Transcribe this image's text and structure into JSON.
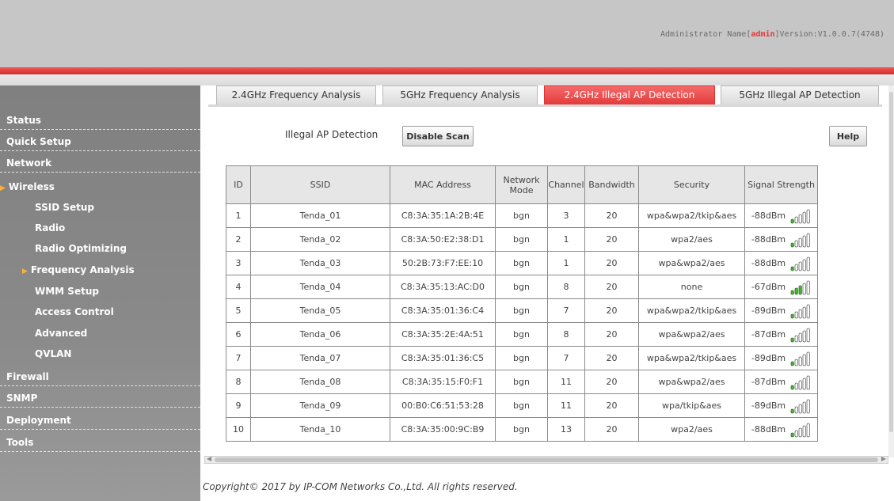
{
  "header": {
    "admin_label": "Administrator Name[",
    "admin_name": "admin",
    "version_label": "]Version:V1.0.0.7(4748)"
  },
  "sidebar": {
    "items": [
      {
        "label": "Status"
      },
      {
        "label": "Quick Setup"
      },
      {
        "label": "Network"
      },
      {
        "label": "Wireless"
      },
      {
        "label": "SSID Setup"
      },
      {
        "label": "Radio"
      },
      {
        "label": "Radio Optimizing"
      },
      {
        "label": "Frequency Analysis"
      },
      {
        "label": "WMM Setup"
      },
      {
        "label": "Access Control"
      },
      {
        "label": "Advanced"
      },
      {
        "label": "QVLAN"
      },
      {
        "label": "Firewall"
      },
      {
        "label": "SNMP"
      },
      {
        "label": "Deployment"
      },
      {
        "label": "Tools"
      }
    ]
  },
  "tabs": [
    {
      "label": "2.4GHz Frequency Analysis"
    },
    {
      "label": "5GHz Frequency Analysis"
    },
    {
      "label": "2.4GHz Illegal AP Detection"
    },
    {
      "label": "5GHz Illegal AP Detection"
    }
  ],
  "scan": {
    "label": "Illegal AP Detection",
    "button": "Disable Scan",
    "help": "Help"
  },
  "table": {
    "headers": {
      "id": "ID",
      "ssid": "SSID",
      "mac": "MAC Address",
      "mode_line1": "Network",
      "mode_line2": "Mode",
      "channel": "Channel",
      "bandwidth": "Bandwidth",
      "security": "Security",
      "signal": "Signal Strength"
    },
    "rows": [
      {
        "id": "1",
        "ssid": "Tenda_01",
        "mac": "C8:3A:35:1A:2B:4E",
        "mode": "bgn",
        "channel": "3",
        "bandwidth": "20",
        "security": "wpa&wpa2/tkip&aes",
        "signal": "-88dBm",
        "bars": 1
      },
      {
        "id": "2",
        "ssid": "Tenda_02",
        "mac": "C8:3A:50:E2:38:D1",
        "mode": "bgn",
        "channel": "1",
        "bandwidth": "20",
        "security": "wpa2/aes",
        "signal": "-88dBm",
        "bars": 1
      },
      {
        "id": "3",
        "ssid": "Tenda_03",
        "mac": "50:2B:73:F7:EE:10",
        "mode": "bgn",
        "channel": "1",
        "bandwidth": "20",
        "security": "wpa&wpa2/aes",
        "signal": "-88dBm",
        "bars": 1
      },
      {
        "id": "4",
        "ssid": "Tenda_04",
        "mac": "C8:3A:35:13:AC:D0",
        "mode": "bgn",
        "channel": "8",
        "bandwidth": "20",
        "security": "none",
        "signal": "-67dBm",
        "bars": 3
      },
      {
        "id": "5",
        "ssid": "Tenda_05",
        "mac": "C8:3A:35:01:36:C4",
        "mode": "bgn",
        "channel": "7",
        "bandwidth": "20",
        "security": "wpa&wpa2/tkip&aes",
        "signal": "-89dBm",
        "bars": 1
      },
      {
        "id": "6",
        "ssid": "Tenda_06",
        "mac": "C8:3A:35:2E:4A:51",
        "mode": "bgn",
        "channel": "8",
        "bandwidth": "20",
        "security": "wpa&wpa2/aes",
        "signal": "-87dBm",
        "bars": 1
      },
      {
        "id": "7",
        "ssid": "Tenda_07",
        "mac": "C8:3A:35:01:36:C5",
        "mode": "bgn",
        "channel": "7",
        "bandwidth": "20",
        "security": "wpa&wpa2/tkip&aes",
        "signal": "-89dBm",
        "bars": 1
      },
      {
        "id": "8",
        "ssid": "Tenda_08",
        "mac": "C8:3A:35:15:F0:F1",
        "mode": "bgn",
        "channel": "11",
        "bandwidth": "20",
        "security": "wpa&wpa2/aes",
        "signal": "-87dBm",
        "bars": 1
      },
      {
        "id": "9",
        "ssid": "Tenda_09",
        "mac": "00:B0:C6:51:53:28",
        "mode": "bgn",
        "channel": "11",
        "bandwidth": "20",
        "security": "wpa/tkip&aes",
        "signal": "-89dBm",
        "bars": 1
      },
      {
        "id": "10",
        "ssid": "Tenda_10",
        "mac": "C8:3A:35:00:9C:B9",
        "mode": "bgn",
        "channel": "13",
        "bandwidth": "20",
        "security": "wpa2/aes",
        "signal": "-88dBm",
        "bars": 1
      }
    ]
  },
  "footer": {
    "copyright": "Copyright© 2017 by IP-COM Networks Co.,Ltd. All rights reserved."
  },
  "colors": {
    "accent": "#e33b3b",
    "sidebar_bg": "#8a8a8a",
    "signal_on": "#4caf3a",
    "signal_off": "#ffffff"
  }
}
